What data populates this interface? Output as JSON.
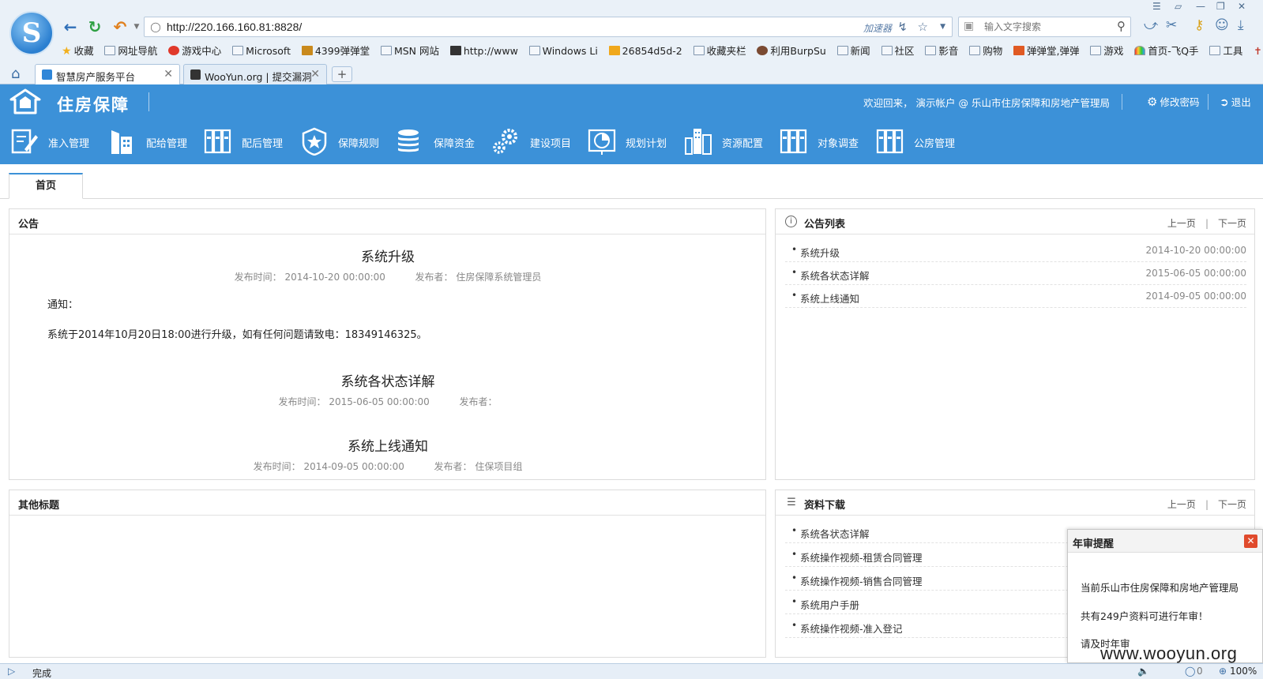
{
  "browser": {
    "url": "http://220.166.160.81:8828/",
    "accelerator_label": "加速器",
    "search_placeholder": "输入文字搜索",
    "bookmarks": [
      "收藏",
      "网址导航",
      "游戏中心",
      "Microsoft",
      "4399弹弹堂",
      "MSN 网站",
      "http://www",
      "Windows Li",
      "26854d5d-2",
      "收藏夹栏",
      "利用BurpSu",
      "新闻",
      "社区",
      "影音",
      "购物",
      "弹弹堂,弹弹",
      "游戏",
      "首页-飞Q手",
      "工具"
    ],
    "tabs": [
      {
        "label": "智慧房产服务平台",
        "active": true
      },
      {
        "label": "WooYun.org | 提交漏洞",
        "active": false
      }
    ],
    "status": "完成",
    "status_zoom": "100%",
    "status_count": "0"
  },
  "app": {
    "title": "住房保障",
    "welcome": "欢迎回来， 演示帐户 @ 乐山市住房保障和房地产管理局",
    "change_password": "修改密码",
    "logout": "退出",
    "brand_color": "#3c91d8",
    "nav": [
      {
        "label": "准入管理",
        "icon": "edit-form-icon"
      },
      {
        "label": "配给管理",
        "icon": "building-icon"
      },
      {
        "label": "配后管理",
        "icon": "binders-icon"
      },
      {
        "label": "保障规则",
        "icon": "badge-star-icon"
      },
      {
        "label": "保障资金",
        "icon": "coins-stack-icon"
      },
      {
        "label": "建设项目",
        "icon": "gears-icon"
      },
      {
        "label": "规划计划",
        "icon": "pie-chart-icon"
      },
      {
        "label": "资源配置",
        "icon": "city-icon"
      },
      {
        "label": "对象调查",
        "icon": "binders-icon"
      },
      {
        "label": "公房管理",
        "icon": "binders-icon"
      }
    ],
    "page_tab": "首页"
  },
  "announcements": {
    "title": "公告",
    "items": [
      {
        "title": "系统升级",
        "time_label": "发布时间：",
        "time": "2014-10-20 00:00:00",
        "author_label": "发布者：",
        "author": "住房保障系统管理员",
        "body_heading": "通知：",
        "body": "系统于2014年10月20日18:00进行升级，如有任何问题请致电：18349146325。"
      },
      {
        "title": "系统各状态详解",
        "time_label": "发布时间：",
        "time": "2015-06-05 00:00:00",
        "author_label": "发布者：",
        "author": ""
      },
      {
        "title": "系统上线通知",
        "time_label": "发布时间：",
        "time": "2014-09-05 00:00:00",
        "author_label": "发布者：",
        "author": "住保项目组"
      }
    ]
  },
  "announcement_list": {
    "title": "公告列表",
    "prev": "上一页",
    "next": "下一页",
    "items": [
      {
        "label": "系统升级",
        "date": "2014-10-20 00:00:00"
      },
      {
        "label": "系统各状态详解",
        "date": "2015-06-05 00:00:00"
      },
      {
        "label": "系统上线通知",
        "date": "2014-09-05 00:00:00"
      }
    ]
  },
  "other": {
    "title": "其他标题"
  },
  "downloads": {
    "title": "资料下载",
    "prev": "上一页",
    "next": "下一页",
    "items": [
      "系统各状态详解",
      "系统操作视频-租赁合同管理",
      "系统操作视频-销售合同管理",
      "系统用户手册",
      "系统操作视频-准入登记"
    ]
  },
  "popup": {
    "title": "年审提醒",
    "line1": "当前乐山市住房保障和房地产管理局",
    "line2": "共有249户资料可进行年审！",
    "line3": "请及时年审"
  },
  "watermark": "www.wooyun.org"
}
